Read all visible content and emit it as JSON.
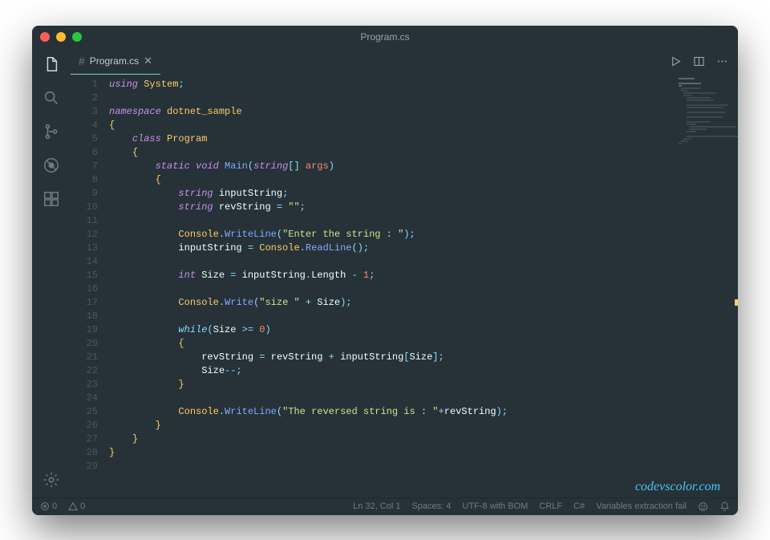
{
  "window": {
    "title": "Program.cs"
  },
  "tab": {
    "label": "Program.cs"
  },
  "watermark": "codevscolor.com",
  "statusbar": {
    "errors": "0",
    "warnings": "0",
    "position": "Ln 32, Col 1",
    "spaces": "Spaces: 4",
    "encoding": "UTF-8 with BOM",
    "eol": "CRLF",
    "language": "C#",
    "extra": "Variables extraction fail"
  },
  "line_numbers": [
    "1",
    "2",
    "3",
    "4",
    "5",
    "6",
    "7",
    "8",
    "9",
    "10",
    "11",
    "12",
    "13",
    "14",
    "15",
    "16",
    "17",
    "18",
    "19",
    "20",
    "21",
    "22",
    "23",
    "24",
    "25",
    "26",
    "27",
    "28",
    "29"
  ],
  "code_lines": [
    [
      {
        "t": "using ",
        "c": "kw-using"
      },
      {
        "t": "System",
        "c": "ident"
      },
      {
        "t": ";",
        "c": "punct"
      }
    ],
    [],
    [
      {
        "t": "namespace ",
        "c": "kw-ns"
      },
      {
        "t": "dotnet_sample",
        "c": "ident-ns"
      }
    ],
    [
      {
        "t": "{",
        "c": "brace"
      }
    ],
    [
      {
        "t": "    ",
        "c": ""
      },
      {
        "t": "class ",
        "c": "kw-cls"
      },
      {
        "t": "Program",
        "c": "class-name"
      }
    ],
    [
      {
        "t": "    ",
        "c": ""
      },
      {
        "t": "{",
        "c": "brace"
      }
    ],
    [
      {
        "t": "        ",
        "c": ""
      },
      {
        "t": "static ",
        "c": "kw-mod"
      },
      {
        "t": "void ",
        "c": "kw-type"
      },
      {
        "t": "Main",
        "c": "fn"
      },
      {
        "t": "(",
        "c": "punct"
      },
      {
        "t": "string",
        "c": "kw-type"
      },
      {
        "t": "[] ",
        "c": "punct"
      },
      {
        "t": "args",
        "c": "param"
      },
      {
        "t": ")",
        "c": "punct"
      }
    ],
    [
      {
        "t": "        ",
        "c": ""
      },
      {
        "t": "{",
        "c": "brace"
      }
    ],
    [
      {
        "t": "            ",
        "c": ""
      },
      {
        "t": "string ",
        "c": "kw-type"
      },
      {
        "t": "inputString",
        "c": "var"
      },
      {
        "t": ";",
        "c": "punct"
      }
    ],
    [
      {
        "t": "            ",
        "c": ""
      },
      {
        "t": "string ",
        "c": "kw-type"
      },
      {
        "t": "revString",
        "c": "var"
      },
      {
        "t": " = ",
        "c": "op"
      },
      {
        "t": "\"\"",
        "c": "str"
      },
      {
        "t": ";",
        "c": "punct"
      }
    ],
    [],
    [
      {
        "t": "            ",
        "c": ""
      },
      {
        "t": "Console",
        "c": "class-name"
      },
      {
        "t": ".",
        "c": "punct"
      },
      {
        "t": "WriteLine",
        "c": "fn"
      },
      {
        "t": "(",
        "c": "punct"
      },
      {
        "t": "\"Enter the string : \"",
        "c": "str"
      },
      {
        "t": ");",
        "c": "punct"
      }
    ],
    [
      {
        "t": "            ",
        "c": ""
      },
      {
        "t": "inputString",
        "c": "var"
      },
      {
        "t": " = ",
        "c": "op"
      },
      {
        "t": "Console",
        "c": "class-name"
      },
      {
        "t": ".",
        "c": "punct"
      },
      {
        "t": "ReadLine",
        "c": "fn"
      },
      {
        "t": "();",
        "c": "punct"
      }
    ],
    [],
    [
      {
        "t": "            ",
        "c": ""
      },
      {
        "t": "int ",
        "c": "kw-type"
      },
      {
        "t": "Size",
        "c": "var"
      },
      {
        "t": " = ",
        "c": "op"
      },
      {
        "t": "inputString",
        "c": "var"
      },
      {
        "t": ".",
        "c": "punct"
      },
      {
        "t": "Length",
        "c": "var"
      },
      {
        "t": " - ",
        "c": "op"
      },
      {
        "t": "1",
        "c": "num"
      },
      {
        "t": ";",
        "c": "punct"
      }
    ],
    [],
    [
      {
        "t": "            ",
        "c": ""
      },
      {
        "t": "Console",
        "c": "class-name"
      },
      {
        "t": ".",
        "c": "punct"
      },
      {
        "t": "Write",
        "c": "fn"
      },
      {
        "t": "(",
        "c": "punct"
      },
      {
        "t": "\"size \"",
        "c": "str"
      },
      {
        "t": " + ",
        "c": "op"
      },
      {
        "t": "Size",
        "c": "var"
      },
      {
        "t": ");",
        "c": "punct"
      }
    ],
    [],
    [
      {
        "t": "            ",
        "c": ""
      },
      {
        "t": "while",
        "c": "kw-ctrl"
      },
      {
        "t": "(",
        "c": "punct"
      },
      {
        "t": "Size",
        "c": "var"
      },
      {
        "t": " >= ",
        "c": "op"
      },
      {
        "t": "0",
        "c": "num"
      },
      {
        "t": ")",
        "c": "punct"
      }
    ],
    [
      {
        "t": "            ",
        "c": ""
      },
      {
        "t": "{",
        "c": "brace"
      }
    ],
    [
      {
        "t": "                ",
        "c": ""
      },
      {
        "t": "revString",
        "c": "var"
      },
      {
        "t": " = ",
        "c": "op"
      },
      {
        "t": "revString",
        "c": "var"
      },
      {
        "t": " + ",
        "c": "op"
      },
      {
        "t": "inputString",
        "c": "var"
      },
      {
        "t": "[",
        "c": "punct"
      },
      {
        "t": "Size",
        "c": "var"
      },
      {
        "t": "];",
        "c": "punct"
      }
    ],
    [
      {
        "t": "                ",
        "c": ""
      },
      {
        "t": "Size",
        "c": "var"
      },
      {
        "t": "--;",
        "c": "punct"
      }
    ],
    [
      {
        "t": "            ",
        "c": ""
      },
      {
        "t": "}",
        "c": "brace"
      }
    ],
    [],
    [
      {
        "t": "            ",
        "c": ""
      },
      {
        "t": "Console",
        "c": "class-name"
      },
      {
        "t": ".",
        "c": "punct"
      },
      {
        "t": "WriteLine",
        "c": "fn"
      },
      {
        "t": "(",
        "c": "punct"
      },
      {
        "t": "\"The reversed string is : \"",
        "c": "str"
      },
      {
        "t": "+",
        "c": "op"
      },
      {
        "t": "revString",
        "c": "var"
      },
      {
        "t": ");",
        "c": "punct"
      }
    ],
    [
      {
        "t": "        ",
        "c": ""
      },
      {
        "t": "}",
        "c": "brace"
      }
    ],
    [
      {
        "t": "    ",
        "c": ""
      },
      {
        "t": "}",
        "c": "brace"
      }
    ],
    [
      {
        "t": "}",
        "c": "brace"
      }
    ],
    []
  ]
}
